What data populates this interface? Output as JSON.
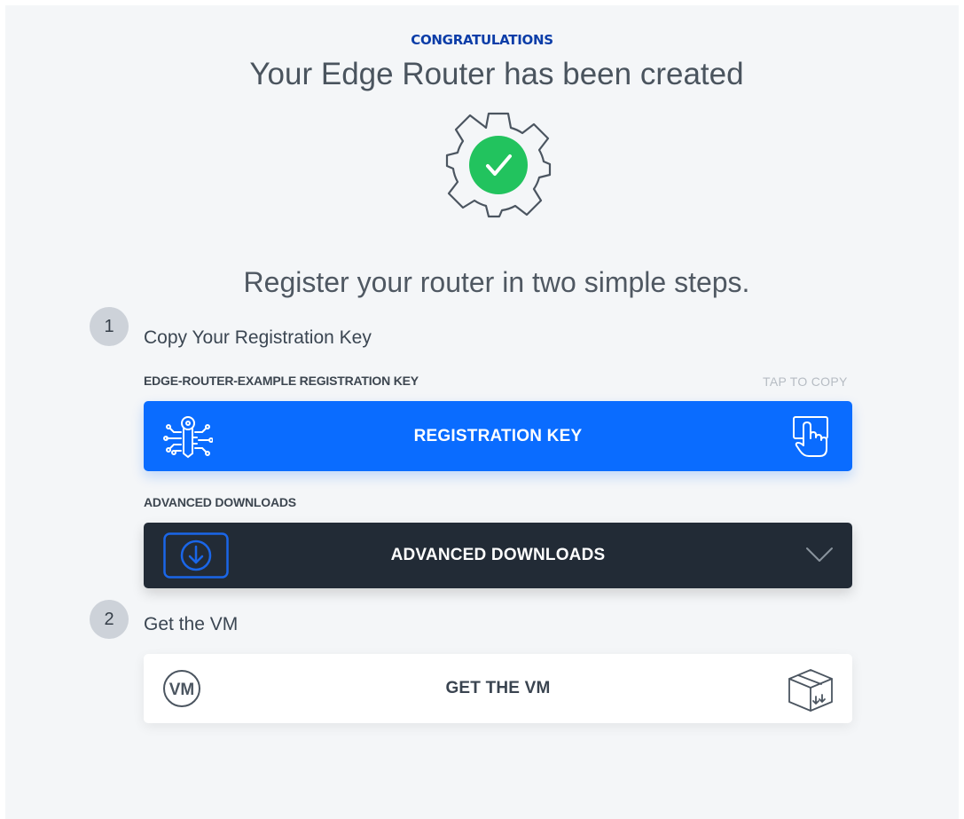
{
  "header": {
    "eyebrow": "CONGRATULATIONS",
    "title": "Your Edge Router has been created",
    "status_icon": "gear-check-icon"
  },
  "intro": "Register your router in two simple steps.",
  "steps": [
    {
      "number": "1",
      "title": "Copy Your Registration Key",
      "registration": {
        "label": "EDGE-ROUTER-EXAMPLE REGISTRATION KEY",
        "hint": "TAP TO COPY",
        "button_label": "REGISTRATION KEY",
        "left_icon": "key-circuit-icon",
        "right_icon": "tap-hand-icon"
      },
      "downloads": {
        "label": "ADVANCED DOWNLOADS",
        "button_label": "ADVANCED DOWNLOADS",
        "left_icon": "download-icon",
        "right_icon": "chevron-down-icon"
      }
    },
    {
      "number": "2",
      "title": "Get the VM",
      "vm": {
        "button_label": "GET THE VM",
        "left_icon": "vm-icon",
        "right_icon": "box-download-icon"
      }
    }
  ],
  "colors": {
    "primary": "#0a6cff",
    "dark": "#222b36",
    "success": "#22c35e",
    "heading_accent": "#0b3da8",
    "background": "#f4f6f8"
  }
}
